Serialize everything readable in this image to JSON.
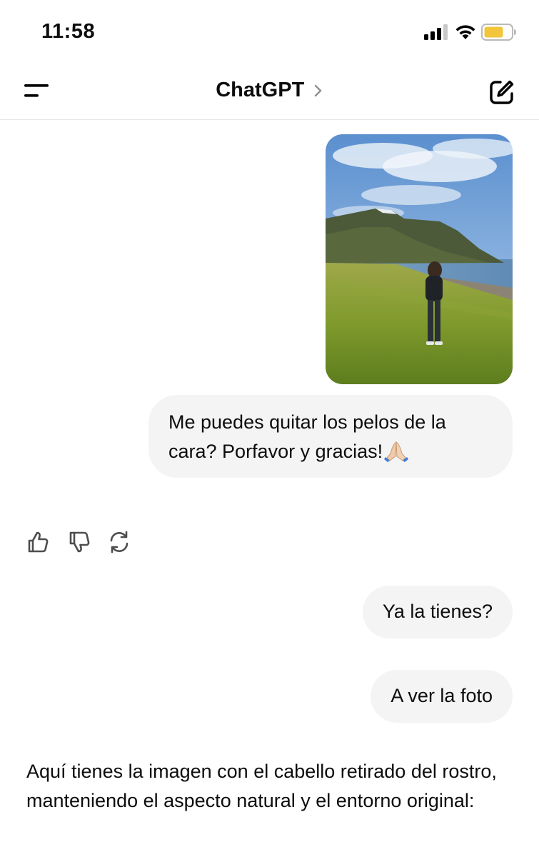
{
  "status_bar": {
    "time": "11:58",
    "battery_color": "#f2c53d"
  },
  "nav": {
    "title": "ChatGPT",
    "menu_icon": "menu-icon",
    "chevron_icon": "chevron-right-icon",
    "compose_icon": "new-chat-icon"
  },
  "conversation": {
    "messages": [
      {
        "role": "user",
        "type": "image",
        "description_icon": "photo-attachment"
      },
      {
        "role": "user",
        "type": "text",
        "text": "Me puedes quitar los pelos de la cara? Porfavor y gracias!",
        "emoji": "folded-hands-emoji"
      },
      {
        "role": "user",
        "type": "text",
        "text": "Ya la tienes?"
      },
      {
        "role": "user",
        "type": "text",
        "text": "A ver la foto"
      },
      {
        "role": "assistant",
        "type": "text",
        "text": "Aquí tienes la imagen con el cabello retirado del rostro, manteniendo el aspecto natural y el entorno original:"
      }
    ],
    "actions": [
      {
        "name": "thumbs-up-icon"
      },
      {
        "name": "thumbs-down-icon"
      },
      {
        "name": "regenerate-icon"
      }
    ]
  },
  "colors": {
    "bubble_bg": "#f4f4f4",
    "text": "#0d0d0d",
    "divider": "#e6e6e6"
  }
}
